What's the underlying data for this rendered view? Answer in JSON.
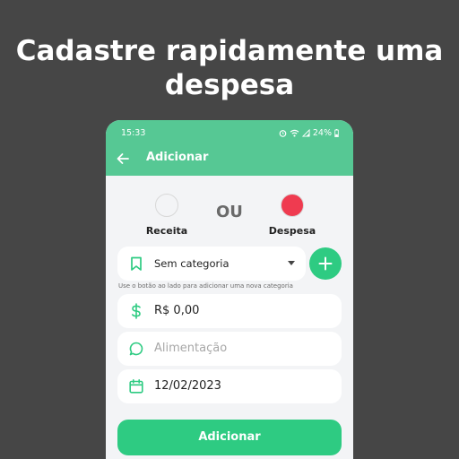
{
  "headline": {
    "line1": "Cadastre rapidamente uma",
    "line2": "despesa"
  },
  "status_bar": {
    "time": "15:33",
    "battery": "24%",
    "icons": [
      "alarm-icon",
      "wifi-icon",
      "signal-icon",
      "battery-icon"
    ]
  },
  "toolbar": {
    "back_icon": "arrow-left-icon",
    "title": "Adicionar"
  },
  "type_selector": {
    "income_label": "Receita",
    "or_label": "OU",
    "expense_label": "Despesa",
    "selected": "Despesa"
  },
  "form": {
    "category": {
      "value": "Sem categoria",
      "icon": "bookmark-icon"
    },
    "add_category_icon": "plus-icon",
    "hint": "Use o botão ao lado para adicionar uma nova categoria",
    "amount": {
      "value": "R$ 0,00",
      "icon": "dollar-icon"
    },
    "description": {
      "placeholder": "Alimentação",
      "icon": "chat-bubble-icon"
    },
    "date": {
      "value": "12/02/2023",
      "icon": "calendar-icon"
    },
    "submit_label": "Adicionar"
  },
  "colors": {
    "background": "#464646",
    "appbar": "#56c894",
    "accent": "#2ecb82",
    "expense": "#ef3b50"
  }
}
